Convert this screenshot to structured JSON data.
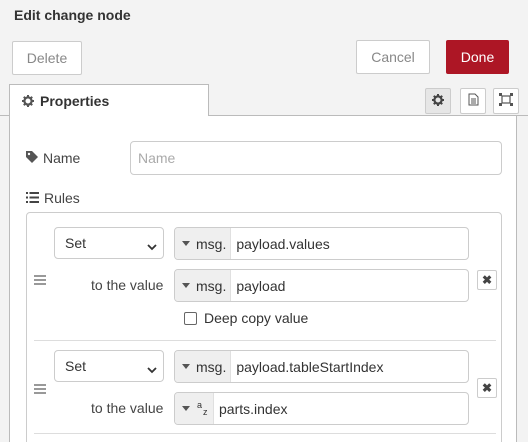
{
  "header": {
    "title": "Edit change node"
  },
  "toolbar": {
    "delete_label": "Delete",
    "cancel_label": "Cancel",
    "done_label": "Done"
  },
  "tabs": [
    {
      "label": "Properties",
      "icon": "gear-icon"
    }
  ],
  "tab_icons": [
    "gear-icon",
    "document-icon",
    "frame-icon"
  ],
  "form": {
    "name_label": "Name",
    "name_placeholder": "Name",
    "name_value": "",
    "rules_label": "Rules"
  },
  "rules": [
    {
      "action": "Set",
      "target_type": "msg.",
      "target_value": "payload.values",
      "to_label": "to the value",
      "value_type": "msg.",
      "value": "payload",
      "deep_copy_label": "Deep copy value",
      "deep_copy_checked": false
    },
    {
      "action": "Set",
      "target_type": "msg.",
      "target_value": "payload.tableStartIndex",
      "to_label": "to the value",
      "value_type": "az",
      "value": "parts.index"
    }
  ],
  "colors": {
    "done": "#ad1625",
    "border": "#cccccc"
  }
}
